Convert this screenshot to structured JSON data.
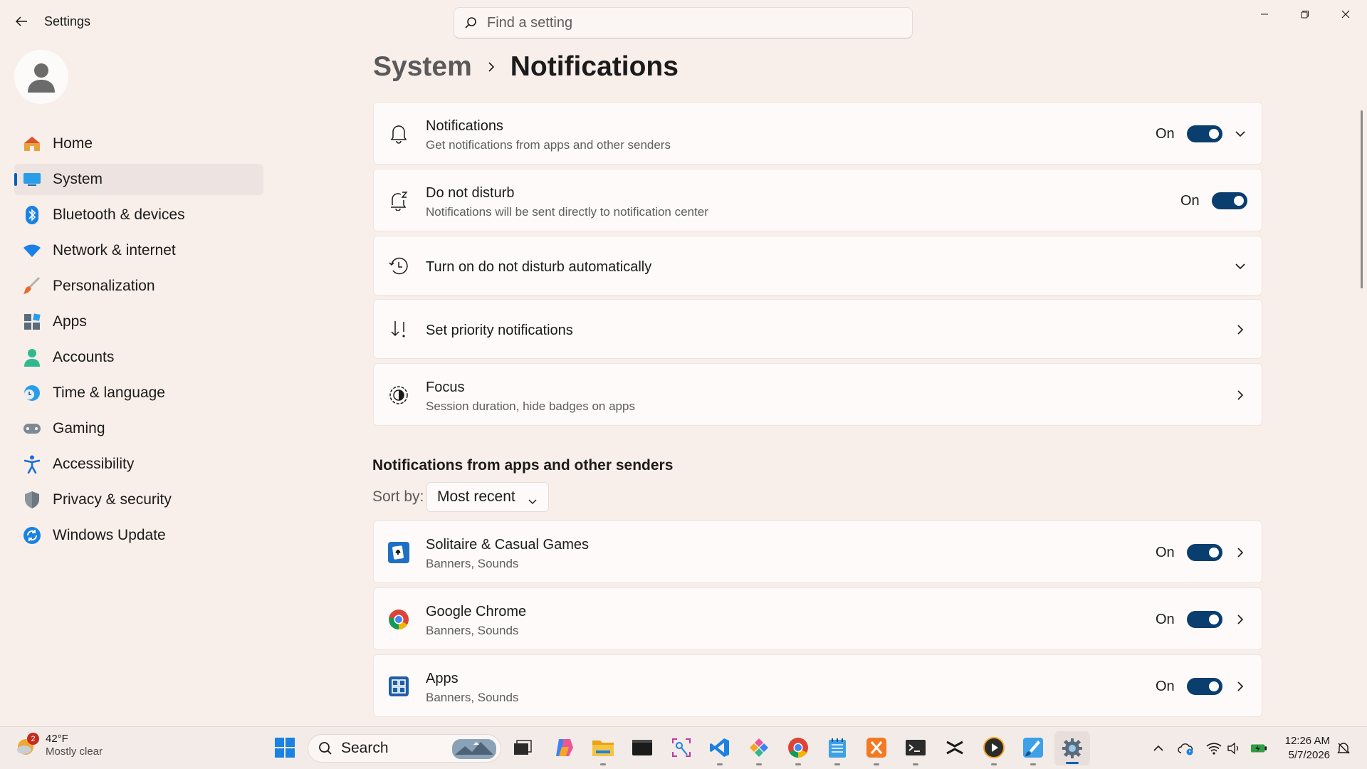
{
  "window": {
    "title": "Settings"
  },
  "search": {
    "placeholder": "Find a setting"
  },
  "nav": {
    "items": [
      {
        "label": "Home"
      },
      {
        "label": "System"
      },
      {
        "label": "Bluetooth & devices"
      },
      {
        "label": "Network & internet"
      },
      {
        "label": "Personalization"
      },
      {
        "label": "Apps"
      },
      {
        "label": "Accounts"
      },
      {
        "label": "Time & language"
      },
      {
        "label": "Gaming"
      },
      {
        "label": "Accessibility"
      },
      {
        "label": "Privacy & security"
      },
      {
        "label": "Windows Update"
      }
    ]
  },
  "breadcrumb": {
    "parent": "System",
    "current": "Notifications"
  },
  "settings": {
    "notifications": {
      "title": "Notifications",
      "subtitle": "Get notifications from apps and other senders",
      "state": "On"
    },
    "dnd": {
      "title": "Do not disturb",
      "subtitle": "Notifications will be sent directly to notification center",
      "state": "On"
    },
    "dnd_auto": {
      "title": "Turn on do not disturb automatically"
    },
    "priority": {
      "title": "Set priority notifications"
    },
    "focus": {
      "title": "Focus",
      "subtitle": "Session duration, hide badges on apps"
    }
  },
  "apps_section": {
    "title": "Notifications from apps and other senders",
    "sort_label": "Sort by:",
    "sort_value": "Most recent",
    "apps": [
      {
        "name": "Solitaire & Casual Games",
        "detail": "Banners, Sounds",
        "state": "On"
      },
      {
        "name": "Google Chrome",
        "detail": "Banners, Sounds",
        "state": "On"
      },
      {
        "name": "Apps",
        "detail": "Banners, Sounds",
        "state": "On"
      }
    ]
  },
  "taskbar": {
    "weather": {
      "temp": "42°F",
      "condition": "Mostly clear",
      "badge": "2"
    },
    "search_label": "Search",
    "clock": {
      "time": "12:26 AM",
      "date": "5/7/2026"
    }
  },
  "colors": {
    "accent": "#005fb8",
    "toggle_on": "#0a3e6e",
    "background": "#f8eeea"
  }
}
